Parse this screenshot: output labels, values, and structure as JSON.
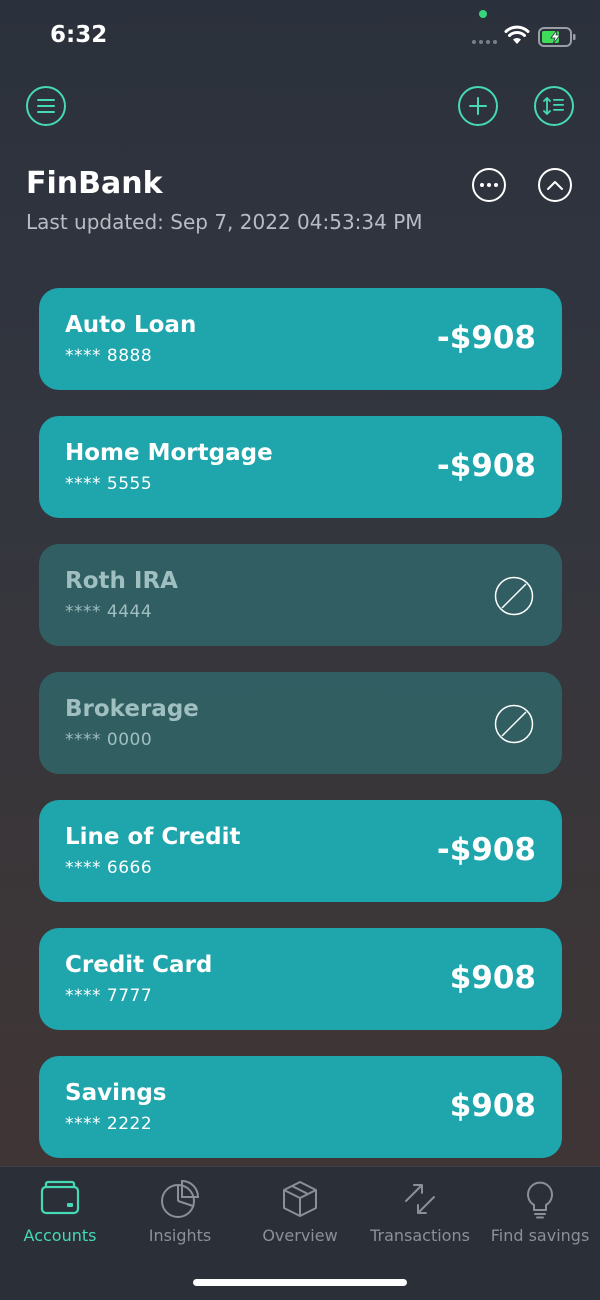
{
  "status": {
    "time": "6:32"
  },
  "header": {
    "bank_name": "FinBank",
    "last_updated": "Last updated: Sep 7, 2022 04:53:34 PM"
  },
  "accounts": [
    {
      "name": "Auto Loan",
      "number": "**** 8888",
      "amount": "-$908",
      "disabled": false
    },
    {
      "name": "Home Mortgage",
      "number": "**** 5555",
      "amount": "-$908",
      "disabled": false
    },
    {
      "name": "Roth IRA",
      "number": "**** 4444",
      "amount": "",
      "disabled": true
    },
    {
      "name": "Brokerage",
      "number": "**** 0000",
      "amount": "",
      "disabled": true
    },
    {
      "name": "Line of Credit",
      "number": "**** 6666",
      "amount": "-$908",
      "disabled": false
    },
    {
      "name": "Credit Card",
      "number": "**** 7777",
      "amount": "$908",
      "disabled": false
    },
    {
      "name": "Savings",
      "number": "**** 2222",
      "amount": "$908",
      "disabled": false
    }
  ],
  "tabs": [
    {
      "label": "Accounts",
      "icon": "wallet-icon",
      "active": true
    },
    {
      "label": "Insights",
      "icon": "pie-chart-icon",
      "active": false
    },
    {
      "label": "Overview",
      "icon": "cube-icon",
      "active": false
    },
    {
      "label": "Transactions",
      "icon": "transfer-arrows-icon",
      "active": false
    },
    {
      "label": "Find savings",
      "icon": "lightbulb-icon",
      "active": false
    }
  ],
  "colors": {
    "accent": "#45d9b5",
    "card": "#1fa5ac",
    "card_disabled": "#2c8082",
    "background": "#2f333c"
  }
}
